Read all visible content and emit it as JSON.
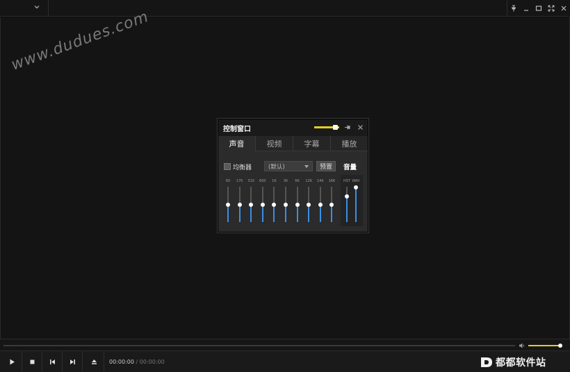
{
  "watermark": "www.dudues.com",
  "panel": {
    "title": "控制窗口",
    "tabs": [
      "声音",
      "视频",
      "字幕",
      "播放"
    ],
    "active_tab": 0,
    "equalizer_label": "均衡器",
    "equalizer_enabled": false,
    "preset_value": "(默认)",
    "preset_button": "预置",
    "volume_title": "音量",
    "bands": [
      {
        "label": "60",
        "level": 0.5
      },
      {
        "label": "170",
        "level": 0.5
      },
      {
        "label": "310",
        "level": 0.5
      },
      {
        "label": "600",
        "level": 0.5
      },
      {
        "label": "1K",
        "level": 0.5
      },
      {
        "label": "3K",
        "level": 0.5
      },
      {
        "label": "6K",
        "level": 0.5
      },
      {
        "label": "12K",
        "level": 0.5
      },
      {
        "label": "14K",
        "level": 0.5
      },
      {
        "label": "16K",
        "level": 0.5
      }
    ],
    "volume_sliders": [
      {
        "label": "HST",
        "level": 0.72
      },
      {
        "label": "WAV",
        "level": 0.98
      }
    ],
    "opacity_level": 0.85
  },
  "player": {
    "current_time": "00:00:00",
    "separator": "/",
    "duration": "00:00:00",
    "volume_level": 0.95,
    "seek_progress": 0
  },
  "brand": {
    "logo_text": "都都软件站"
  },
  "colors": {
    "accent_yellow": "#e6cf1e",
    "eq_blue": "#3a8ee6"
  }
}
